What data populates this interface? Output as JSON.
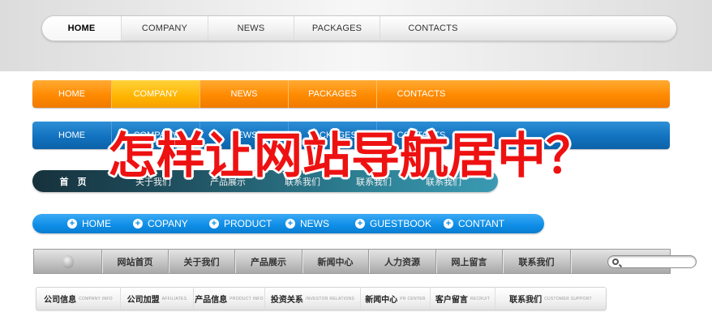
{
  "nav_silver": {
    "items": [
      "HOME",
      "COMPANY",
      "NEWS",
      "PACKAGES",
      "CONTACTS"
    ]
  },
  "nav_orange": {
    "items": [
      "HOME",
      "COMPANY",
      "NEWS",
      "PACKAGES",
      "CONTACTS"
    ]
  },
  "nav_blue": {
    "items": [
      "HOME",
      "COMPANY",
      "NEWS",
      "PACKAGES",
      "CONTACTS"
    ]
  },
  "nav_teal": {
    "items": [
      "首 页",
      "关于我们",
      "产品展示",
      "联系我们",
      "联系我们",
      "联系我们"
    ]
  },
  "nav_skyblue": {
    "items": [
      "HOME",
      "COPANY",
      "PRODUCT",
      "NEWS",
      "GUESTBOOK",
      "CONTANT"
    ]
  },
  "nav_grey": {
    "items": [
      "网站首页",
      "关于我们",
      "产品展示",
      "新闻中心",
      "人力资源",
      "网上留言",
      "联系我们"
    ],
    "search_placeholder": ""
  },
  "nav_light": {
    "items": [
      {
        "zh": "公司信息",
        "en": "COMPANY INFO"
      },
      {
        "zh": "公司加盟",
        "en": "AFFILIATES"
      },
      {
        "zh": "产品信息",
        "en": "PRODUCT INFO"
      },
      {
        "zh": "投资关系",
        "en": "INVESTOR RELATIONS"
      },
      {
        "zh": "新闻中心",
        "en": "PR CENTER"
      },
      {
        "zh": "客户留言",
        "en": "RECRUIT"
      },
      {
        "zh": "联系我们",
        "en": "CUSTOMER SUPPORT"
      }
    ]
  },
  "overlay": {
    "question": "怎样让网站导航居中？"
  },
  "colors": {
    "overlay_red": "#ee1111",
    "orange": "#ff8a00",
    "blue": "#1272bf",
    "sky": "#0e8de6",
    "teal": "#1f4f5e"
  }
}
